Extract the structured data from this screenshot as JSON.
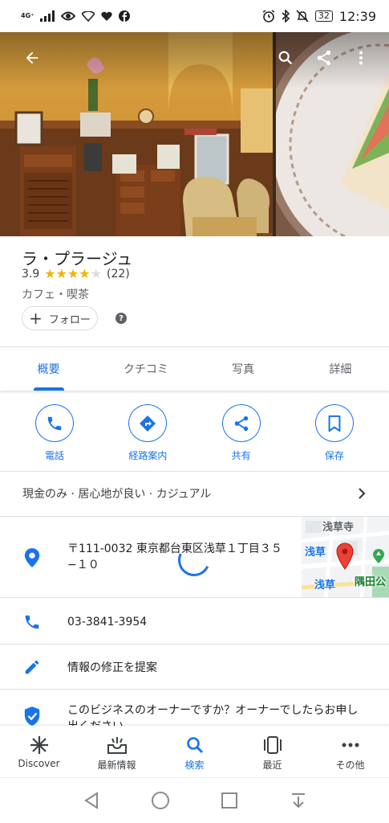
{
  "status_bar": {
    "network": "4G⁺",
    "battery": "32",
    "time": "12:39"
  },
  "place": {
    "title": "ラ・プラージュ",
    "rating": "3.9",
    "stars_filled": 4,
    "review_count": "(22)",
    "category": "カフェ・喫茶",
    "follow_label": "フォロー",
    "help": "?"
  },
  "tabs": [
    {
      "label": "概要",
      "active": true
    },
    {
      "label": "クチコミ"
    },
    {
      "label": "写真"
    },
    {
      "label": "詳細"
    }
  ],
  "actions": [
    {
      "label": "電話",
      "icon": "phone-icon"
    },
    {
      "label": "経路案内",
      "icon": "directions-icon"
    },
    {
      "label": "共有",
      "icon": "share-icon"
    },
    {
      "label": "保存",
      "icon": "bookmark-icon"
    }
  ],
  "attributes": "現金のみ · 居心地が良い · カジュアル",
  "address": "〒111-0032 東京都台東区浅草１丁目３５−１０",
  "map_labels": {
    "senso_ji": "浅草寺",
    "asakusa1": "浅草",
    "asakusa2": "浅草",
    "sumida": "隅田公"
  },
  "phone": "03-3841-3954",
  "suggest_edit": "情報の修正を提案",
  "owner_prompt": "このビジネスのオーナーですか？オーナーでしたらお申し出ください。",
  "bottom_nav": [
    {
      "label": "Discover",
      "icon": "discover-icon"
    },
    {
      "label": "最新情報",
      "icon": "updates-icon"
    },
    {
      "label": "検索",
      "icon": "search-icon",
      "active": true
    },
    {
      "label": "最近",
      "icon": "recent-icon"
    },
    {
      "label": "その他",
      "icon": "more-icon"
    }
  ],
  "colors": {
    "accent": "#1a73e8",
    "star": "#f4b400",
    "map_pin": "#ea4335"
  }
}
